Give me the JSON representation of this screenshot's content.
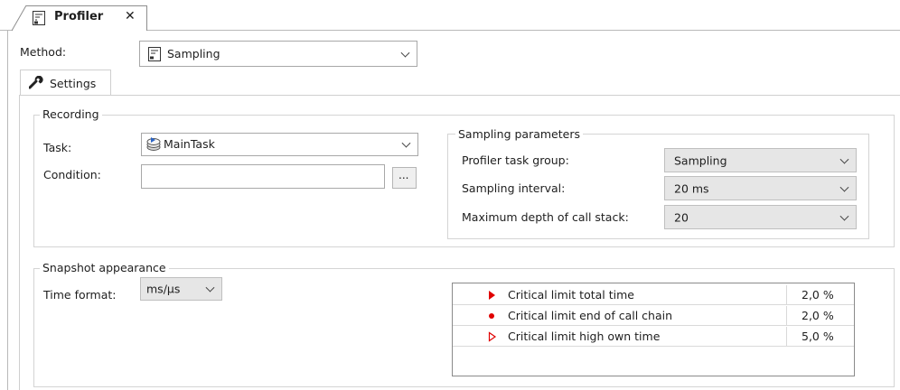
{
  "tab": {
    "title": "Profiler",
    "close": "✕"
  },
  "method": {
    "label": "Method:",
    "value": "Sampling"
  },
  "settings_tab": {
    "label": "Settings"
  },
  "recording": {
    "title": "Recording",
    "task_label": "Task:",
    "task_value": "MainTask",
    "condition_label": "Condition:",
    "condition_value": "",
    "browse_label": "..."
  },
  "sampling": {
    "title": "Sampling parameters",
    "task_group_label": "Profiler task group:",
    "task_group_value": "Sampling",
    "interval_label": "Sampling interval:",
    "interval_value": "20 ms",
    "depth_label": "Maximum depth of call stack:",
    "depth_value": "20"
  },
  "snapshot": {
    "title": "Snapshot appearance",
    "time_format_label": "Time format:",
    "time_format_value": "ms/µs",
    "limits": [
      {
        "icon": "filled-triangle-icon",
        "name": "Critical limit total time",
        "value": "2,0 %"
      },
      {
        "icon": "dot-icon",
        "name": "Critical limit end of call chain",
        "value": "2,0 %"
      },
      {
        "icon": "outline-triangle-icon",
        "name": "Critical limit high own time",
        "value": "5,0 %"
      }
    ]
  },
  "colors": {
    "critical": "#e00000",
    "tab_border": "#8e8e8e",
    "panel_border": "#d4d4d4"
  }
}
